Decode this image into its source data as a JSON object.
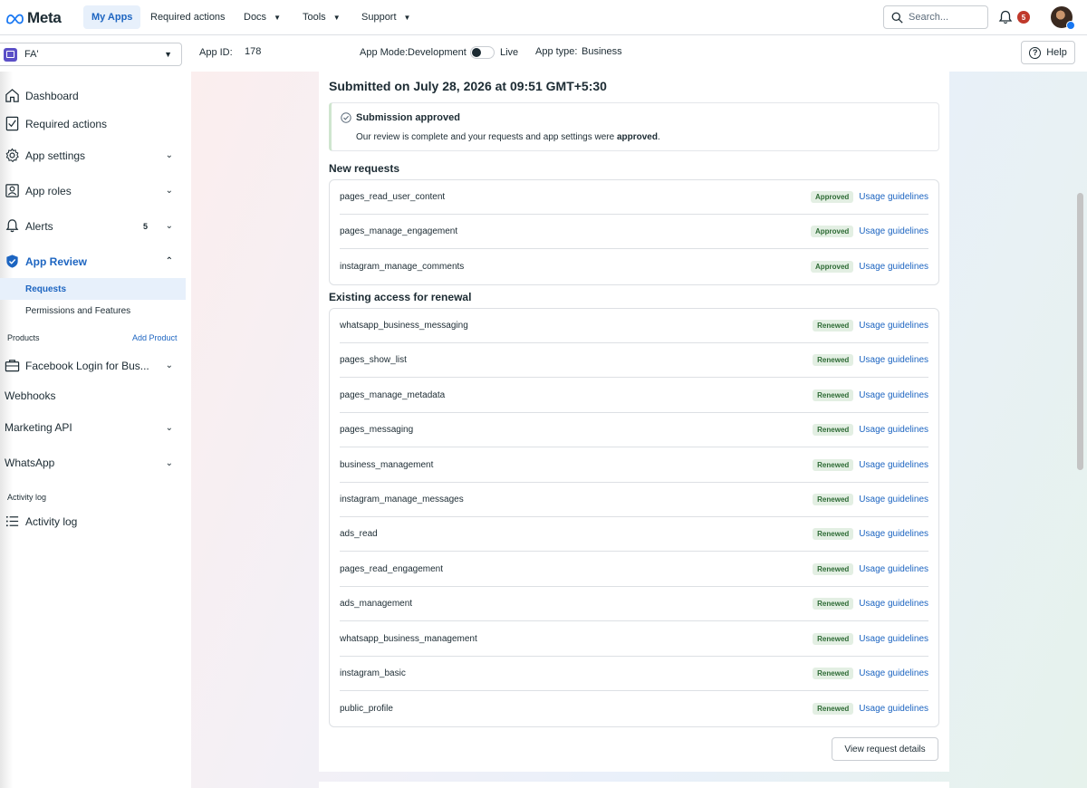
{
  "brand": {
    "name": "Meta"
  },
  "topnav": {
    "items": [
      {
        "label": "My Apps",
        "active": true
      },
      {
        "label": "Required actions"
      },
      {
        "label": "Docs",
        "caret": true
      },
      {
        "label": "Tools",
        "caret": true
      },
      {
        "label": "Support",
        "caret": true
      }
    ],
    "search_placeholder": "Search...",
    "notification_count": "5"
  },
  "subbar": {
    "app_name": "FA'",
    "app_id_label": "App ID:",
    "app_id_value": "178",
    "app_mode_label": "App Mode:",
    "app_mode_value": "Development",
    "live_label": "Live",
    "app_type_label": "App type:",
    "app_type_value": "Business",
    "help_label": "Help"
  },
  "sidebar": {
    "dashboard": "Dashboard",
    "required_actions": "Required actions",
    "app_settings": "App settings",
    "app_roles": "App roles",
    "alerts": "Alerts",
    "alerts_count": "5",
    "app_review": "App Review",
    "requests": "Requests",
    "permissions_features": "Permissions and Features",
    "products_section": "Products",
    "add_product": "Add Product",
    "facebook_login": "Facebook Login for Bus...",
    "webhooks": "Webhooks",
    "marketing_api": "Marketing API",
    "whatsapp": "WhatsApp",
    "activity_section": "Activity log",
    "activity_log": "Activity log"
  },
  "main": {
    "submitted_title": "Submitted on July 28, 2026 at 09:51 GMT+5:30",
    "approved_title": "Submission approved",
    "approved_desc_pre": "Our review is complete and your requests and app settings were ",
    "approved_desc_bold": "approved",
    "approved_desc_post": ".",
    "new_requests_title": "New requests",
    "existing_title": "Existing access for renewal",
    "usage_link": "Usage guidelines",
    "approved_pill": "Approved",
    "renewed_pill": "Renewed",
    "new_requests": [
      "pages_read_user_content",
      "pages_manage_engagement",
      "instagram_manage_comments"
    ],
    "existing": [
      "whatsapp_business_messaging",
      "pages_show_list",
      "pages_manage_metadata",
      "pages_messaging",
      "business_management",
      "instagram_manage_messages",
      "ads_read",
      "pages_read_engagement",
      "ads_management",
      "whatsapp_business_management",
      "instagram_basic",
      "public_profile"
    ],
    "view_details": "View request details"
  }
}
